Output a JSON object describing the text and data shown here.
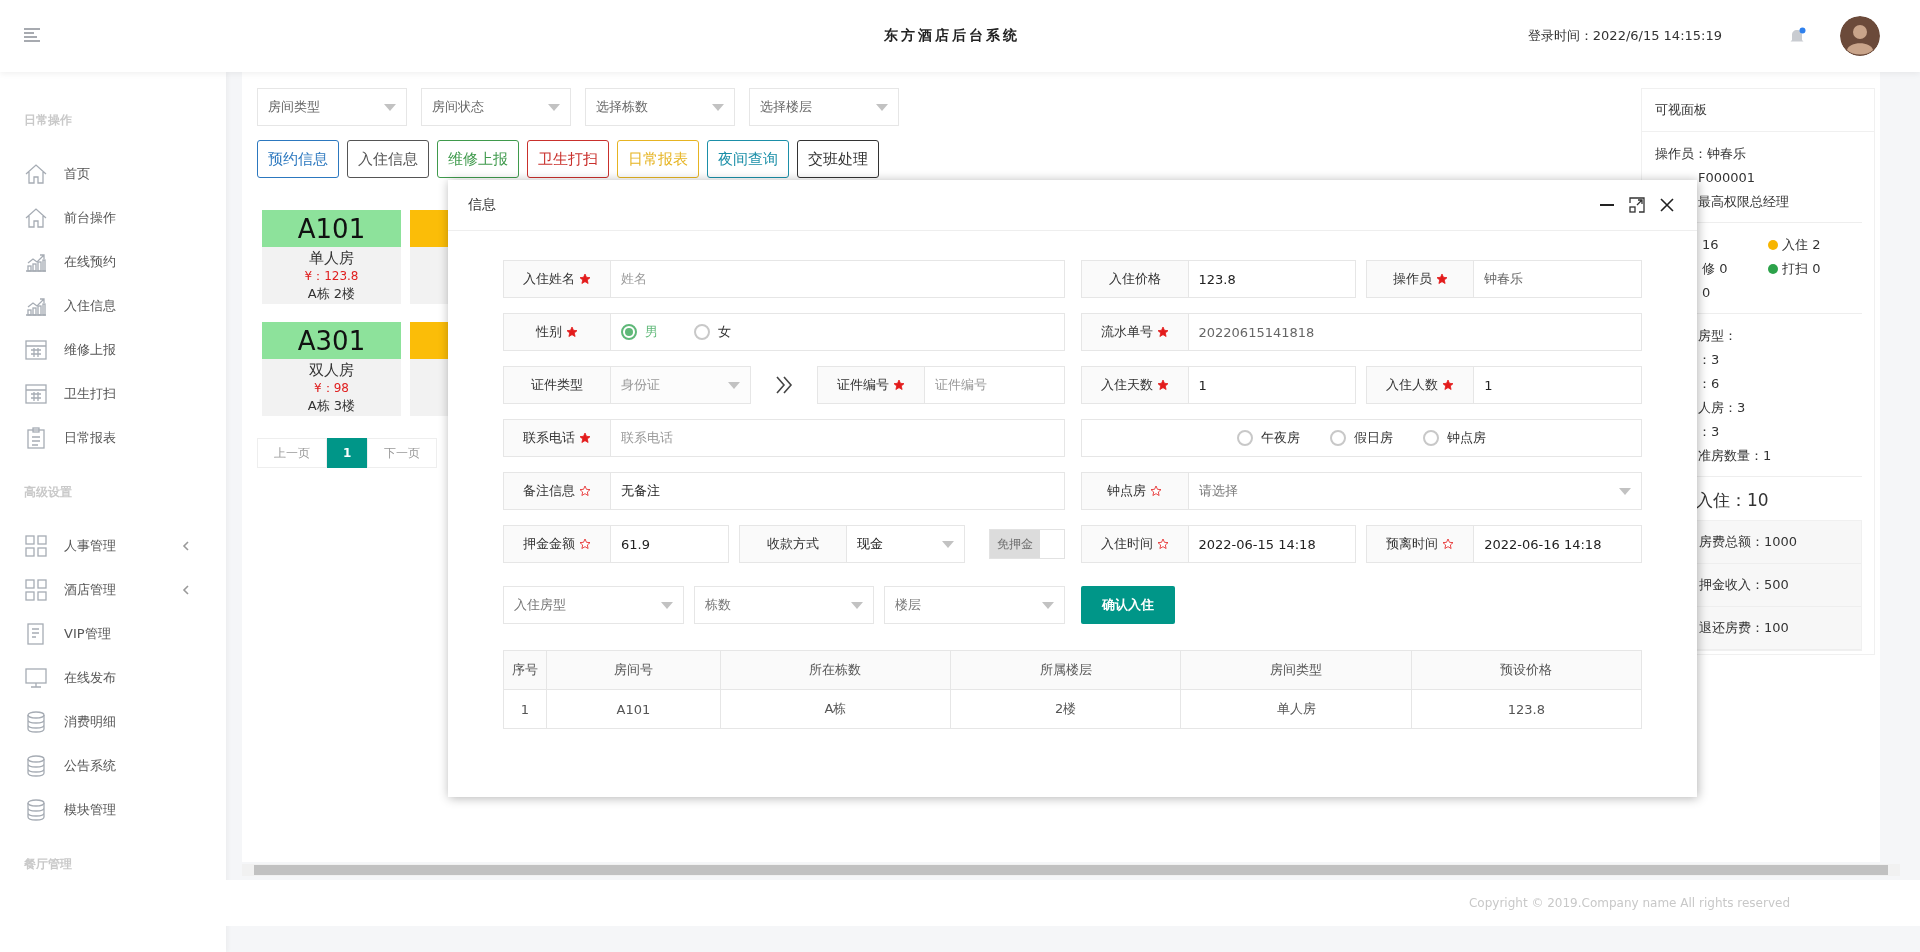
{
  "header": {
    "title": "东方酒店后台系统",
    "login_time": "登录时间：2022/6/15 14:15:19",
    "has_notification": true
  },
  "sidebar": {
    "sections": [
      {
        "title": "日常操作",
        "items": [
          {
            "label": "首页",
            "kind": "link"
          },
          {
            "label": "前台操作",
            "kind": "link"
          },
          {
            "label": "在线预约",
            "kind": "link"
          },
          {
            "label": "入住信息",
            "kind": "link"
          },
          {
            "label": "维修上报",
            "kind": "link"
          },
          {
            "label": "卫生打扫",
            "kind": "link"
          },
          {
            "label": "日常报表",
            "kind": "link"
          }
        ]
      },
      {
        "title": "高级设置",
        "items": [
          {
            "label": "人事管理",
            "kind": "group",
            "expanded": false
          },
          {
            "label": "酒店管理",
            "kind": "group",
            "expanded": false
          },
          {
            "label": "VIP管理",
            "kind": "link"
          },
          {
            "label": "在线发布",
            "kind": "link"
          },
          {
            "label": "消费明细",
            "kind": "link"
          },
          {
            "label": "公告系统",
            "kind": "link"
          },
          {
            "label": "模块管理",
            "kind": "link"
          }
        ]
      },
      {
        "title": "餐厅管理"
      }
    ]
  },
  "filters": [
    {
      "placeholder": "房间类型"
    },
    {
      "placeholder": "房间状态"
    },
    {
      "placeholder": "选择栋数"
    },
    {
      "placeholder": "选择楼层"
    }
  ],
  "actions": [
    {
      "label": "预约信息",
      "color": "#2c78bf"
    },
    {
      "label": "入住信息",
      "color": "#555555"
    },
    {
      "label": "维修上报",
      "color": "#3f9a4c"
    },
    {
      "label": "卫生打扫",
      "color": "#c9302c"
    },
    {
      "label": "日常报表",
      "color": "#e6b422"
    },
    {
      "label": "夜间查询",
      "color": "#1b8fa8"
    },
    {
      "label": "交班处理",
      "color": "#333333"
    }
  ],
  "rooms": [
    {
      "number": "A101",
      "type": "单人房",
      "price": "¥：123.8",
      "location": "A栋 2楼",
      "color": "#8de29b"
    },
    {
      "color": "#fbbd08"
    },
    {
      "number": "A301",
      "type": "双人房",
      "price": "¥：98",
      "location": "A栋 3楼",
      "color": "#8de29b"
    },
    {
      "color": "#fbbd08"
    }
  ],
  "pagination": {
    "prev": {
      "label": "上一页",
      "disabled": true
    },
    "pages": [
      {
        "label": "1",
        "selected": true
      }
    ],
    "next": {
      "label": "下一页",
      "disabled": true
    }
  },
  "panel": {
    "title": "可视面板",
    "operator": "操作员：钟春乐",
    "staff_lines": [
      "F000001",
      "最高权限总经理"
    ],
    "status": [
      {
        "text": "16"
      },
      {
        "text": "入住 2",
        "color": "#f7b500"
      },
      {
        "text": "修 0"
      },
      {
        "text": "打扫 0",
        "color": "#2ca24a"
      },
      {
        "text": "0"
      }
    ],
    "room_types": [
      "房型：",
      "：3",
      "：6",
      "人房：3",
      "：3",
      "准房数量：1"
    ],
    "checked_in": "入住：10",
    "totals": [
      "房费总额：1000",
      "押金收入：500",
      "退还房费：100"
    ]
  },
  "dialog": {
    "title": "信息",
    "left_rows": [
      {
        "items": [
          {
            "kind": "input",
            "label": "入住姓名",
            "star_filled": true,
            "placeholder": "姓名",
            "readonly": false
          }
        ]
      },
      {
        "items": [
          {
            "kind": "radios",
            "label": "性别",
            "star_filled": true,
            "options": [
              {
                "label": "男",
                "selected": true
              },
              {
                "label": "女",
                "selected": false
              }
            ]
          }
        ]
      },
      {
        "items": [
          {
            "kind": "select",
            "label": "证件类型",
            "placeholder": "身份证",
            "disabled": true
          },
          {
            "kind": "arrow"
          },
          {
            "kind": "input",
            "label": "证件编号",
            "star_filled": true,
            "placeholder": "证件编号",
            "readonly": false
          }
        ]
      },
      {
        "items": [
          {
            "kind": "input",
            "label": "联系电话",
            "star_filled": true,
            "placeholder": "联系电话",
            "readonly": false
          }
        ]
      },
      {
        "items": [
          {
            "kind": "input",
            "label": "备注信息",
            "star_filled": false,
            "value": "无备注",
            "readonly": false
          }
        ]
      },
      {
        "items": [
          {
            "kind": "input",
            "label": "押金金额",
            "star_filled": false,
            "value": "61.9",
            "readonly": false
          },
          {
            "kind": "select",
            "label": "收款方式",
            "value": "现金",
            "disabled": false
          },
          {
            "kind": "toggle",
            "label": "免押金",
            "on": false
          }
        ]
      },
      {
        "items": [
          {
            "kind": "select",
            "placeholder": "入住房型",
            "disabled": false
          },
          {
            "kind": "select",
            "placeholder": "栋数",
            "disabled": false
          },
          {
            "kind": "select",
            "placeholder": "楼层",
            "disabled": false
          }
        ]
      }
    ],
    "right_rows": [
      {
        "items": [
          {
            "kind": "input",
            "label": "入住价格",
            "value": "123.8",
            "readonly": false
          },
          {
            "kind": "input",
            "label": "操作员",
            "star_filled": true,
            "value": "钟春乐",
            "readonly": true
          }
        ]
      },
      {
        "items": [
          {
            "kind": "input",
            "label": "流水单号",
            "star_filled": true,
            "value": "20220615141818",
            "readonly": true
          }
        ]
      },
      {
        "items": [
          {
            "kind": "input",
            "label": "入住天数",
            "star_filled": true,
            "value": "1",
            "readonly": false
          },
          {
            "kind": "input",
            "label": "入住人数",
            "star_filled": true,
            "value": "1",
            "readonly": false
          }
        ]
      },
      {
        "items": [
          {
            "kind": "radios",
            "options": [
              {
                "label": "午夜房",
                "selected": false
              },
              {
                "label": "假日房",
                "selected": false
              },
              {
                "label": "钟点房",
                "selected": false
              }
            ]
          }
        ]
      },
      {
        "items": [
          {
            "kind": "select",
            "label": "钟点房",
            "star_filled": false,
            "placeholder": "请选择",
            "disabled": false
          }
        ]
      },
      {
        "items": [
          {
            "kind": "input",
            "label": "入住时间",
            "star_filled": false,
            "value": "2022-06-15 14:18",
            "readonly": false
          },
          {
            "kind": "input",
            "label": "预离时间",
            "star_filled": false,
            "value": "2022-06-16 14:18",
            "readonly": false
          }
        ]
      },
      {
        "items": [
          {
            "kind": "button",
            "label": "确认入住"
          }
        ]
      }
    ],
    "table": {
      "columns": [
        "序号",
        "房间号",
        "所在栋数",
        "所属楼层",
        "房间类型",
        "预设价格"
      ],
      "rows": [
        [
          "1",
          "A101",
          "A栋",
          "2楼",
          "单人房",
          "123.8"
        ]
      ]
    }
  },
  "footer": {
    "copyright": "Copyright © 2019.Company name All rights reserved"
  }
}
